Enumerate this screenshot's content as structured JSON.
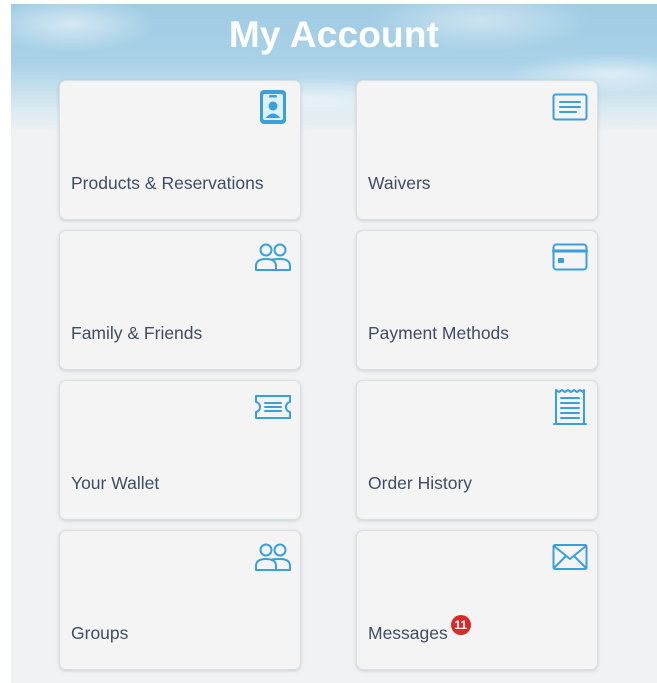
{
  "page": {
    "title": "My Account",
    "accent_color": "#3aa0dc",
    "badge_color": "#d42b2b"
  },
  "cards": [
    {
      "label": "Products & Reservations",
      "icon": "id-badge-icon"
    },
    {
      "label": "Waivers",
      "icon": "document-lines-icon"
    },
    {
      "label": "Family & Friends",
      "icon": "people-icon"
    },
    {
      "label": "Payment Methods",
      "icon": "credit-card-icon"
    },
    {
      "label": "Your Wallet",
      "icon": "ticket-icon"
    },
    {
      "label": "Order History",
      "icon": "receipt-icon"
    },
    {
      "label": "Groups",
      "icon": "people-icon"
    },
    {
      "label": "Messages",
      "icon": "envelope-icon",
      "badge": "11"
    }
  ]
}
